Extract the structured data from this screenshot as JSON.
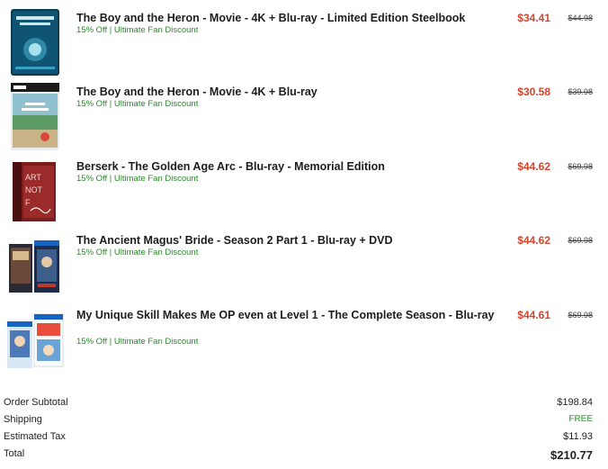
{
  "cart": {
    "items": [
      {
        "title": "The Boy and the Heron - Movie - 4K + Blu-ray - Limited Edition Steelbook",
        "discount": "15% Off | Ultimate Fan Discount",
        "price": "$34.41",
        "original_price": "$44.98",
        "cover_text": "THE BOY AND THE HERON"
      },
      {
        "title": "The Boy and the Heron - Movie - 4K + Blu-ray",
        "discount": "15% Off | Ultimate Fan Discount",
        "price": "$30.58",
        "original_price": "$39.98",
        "cover_text": "THE BOY AND THE HERON"
      },
      {
        "title": "Berserk - The Golden Age Arc - Blu-ray - Memorial Edition",
        "discount": "15% Off | Ultimate Fan Discount",
        "price": "$44.62",
        "original_price": "$69.98",
        "cover_text": "ART NOT F"
      },
      {
        "title": "The Ancient Magus' Bride - Season 2 Part 1 - Blu-ray + DVD",
        "discount": "15% Off | Ultimate Fan Discount",
        "price": "$44.62",
        "original_price": "$69.98",
        "cover_text": ""
      },
      {
        "title": "My Unique Skill Makes Me OP even at Level 1 - The Complete Season - Blu-ray",
        "discount": "15% Off | Ultimate Fan Discount",
        "price": "$44.61",
        "original_price": "$69.98",
        "cover_text": ""
      }
    ]
  },
  "summary": {
    "subtotal_label": "Order Subtotal",
    "subtotal_value": "$198.84",
    "shipping_label": "Shipping",
    "shipping_value": "FREE",
    "tax_label": "Estimated Tax",
    "tax_value": "$11.93",
    "total_label": "Total",
    "total_value": "$210.77"
  },
  "colors": {
    "price": "#d4452c",
    "discount": "#2b8a2b",
    "free": "#5cb85c"
  }
}
